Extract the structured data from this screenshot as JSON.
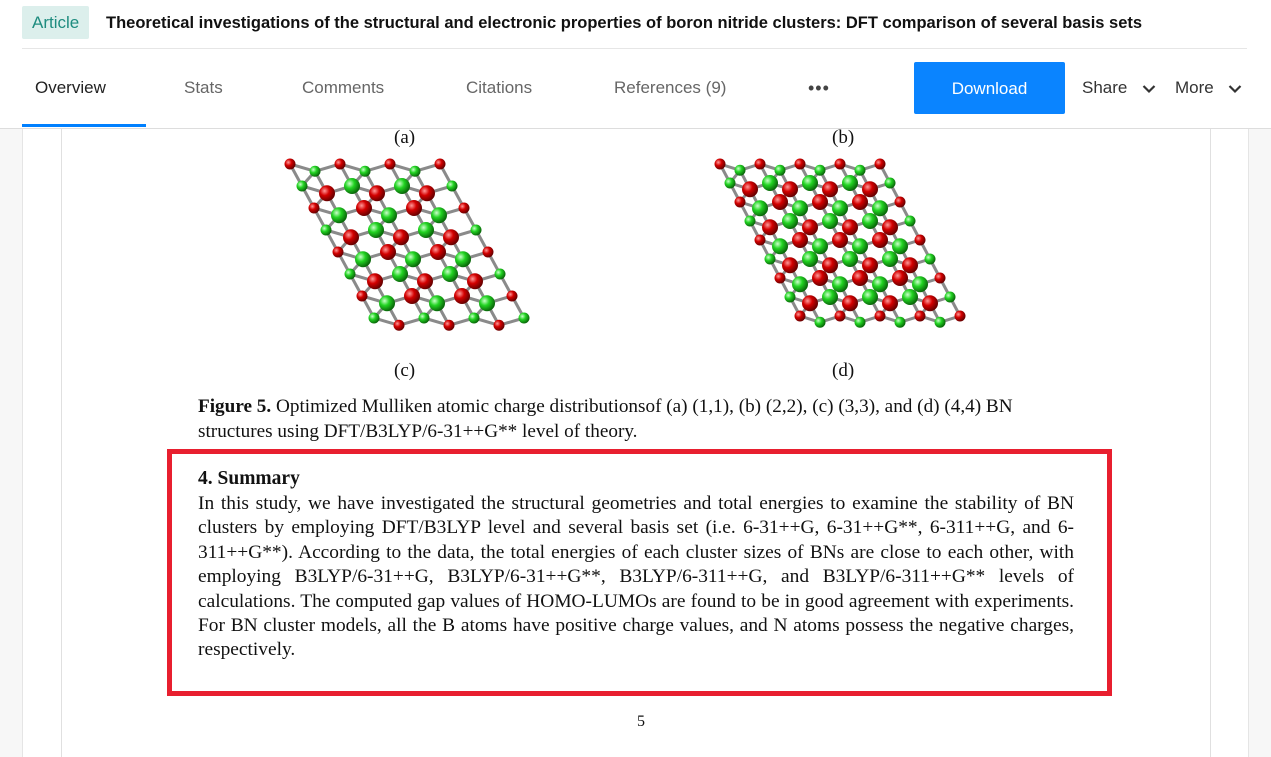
{
  "header": {
    "badge": "Article",
    "title": "Theoretical investigations of the structural and electronic properties of boron nitride clusters: DFT comparison of several basis sets"
  },
  "tabs": [
    {
      "label": "Overview",
      "active": true
    },
    {
      "label": "Stats"
    },
    {
      "label": "Comments"
    },
    {
      "label": "Citations"
    },
    {
      "label": "References (9)"
    }
  ],
  "actions": {
    "more_tabs": "•••",
    "download": "Download",
    "share": "Share",
    "more": "More"
  },
  "figure": {
    "panel_labels": [
      "(a)",
      "(b)",
      "(c)",
      "(d)"
    ],
    "caption_label": "Figure 5.",
    "caption_text": "Optimized Mulliken atomic charge distributionsof (a) (1,1), (b) (2,2), (c) (3,3), and (d) (4,4) BN structures using DFT/B3LYP/6-31++G** level of theory."
  },
  "summary": {
    "heading": "4.  Summary",
    "body": "In this study, we have investigated the structural geometries and total energies to examine the stability of BN clusters by employing DFT/B3LYP level and several basis set (i.e. 6-31++G, 6-31++G**, 6-311++G, and 6-311++G**). According to the data, the total energies of each cluster sizes of BNs are close to each other, with employing B3LYP/6-31++G, B3LYP/6-31++G**, B3LYP/6-311++G, and B3LYP/6-311++G** levels of calculations. The computed gap values of HOMO-LUMOs are found to be in good agreement with experiments. For BN cluster models, all the B atoms have positive charge values, and N atoms possess the negative charges, respectively."
  },
  "page_number": "5",
  "colors": {
    "accent": "#0a84ff",
    "badge_bg": "#dcefec",
    "badge_text": "#1e8c7f",
    "highlight": "#e81f2f",
    "atom_red": "#d40000",
    "atom_green": "#22d422"
  }
}
